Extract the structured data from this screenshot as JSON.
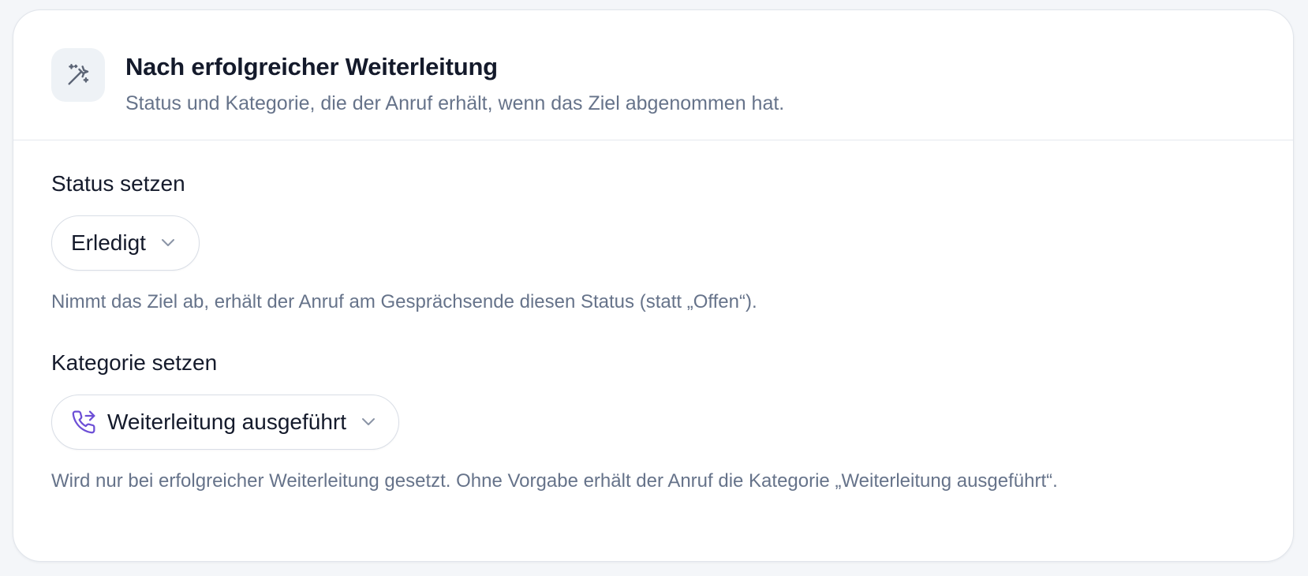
{
  "header": {
    "icon": "magic-wand-icon",
    "title": "Nach erfolgreicher Weiterleitung",
    "subtitle": "Status und Kategorie, die der Anruf erhält, wenn das Ziel abgenommen hat."
  },
  "status_section": {
    "label": "Status setzen",
    "selected_value": "Erledigt",
    "help_text": "Nimmt das Ziel ab, erhält der Anruf am Gesprächsende diesen Status (statt „Offen“)."
  },
  "category_section": {
    "label": "Kategorie setzen",
    "selected_icon": "phone-forward-icon",
    "selected_value": "Weiterleitung ausgeführt",
    "help_text": "Wird nur bei erfolgreicher Weiterleitung gesetzt. Ohne Vorgabe erhält der Anruf die Kategorie „Weiterleitung ausgeführt“."
  },
  "colors": {
    "title_text": "#141a2b",
    "muted_text": "#66738a",
    "category_icon_accent": "#6d4fd6",
    "header_icon_bg": "#eef2f6"
  }
}
